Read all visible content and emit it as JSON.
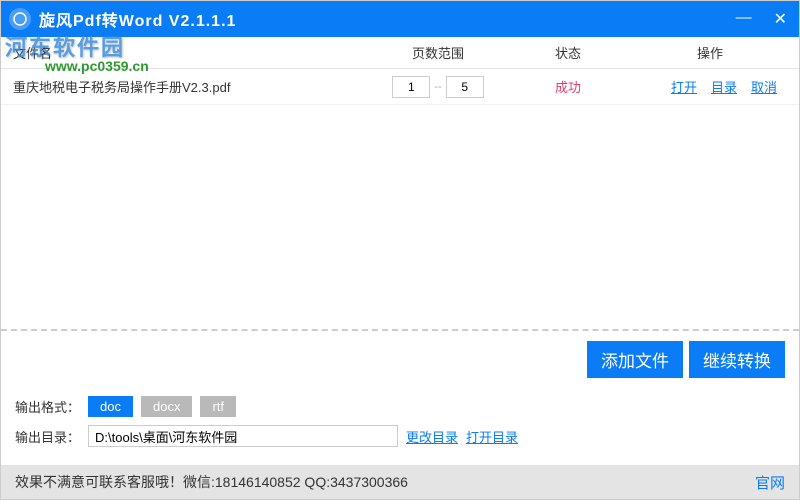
{
  "titlebar": {
    "title": "旋风Pdf转Word  V2.1.1.1"
  },
  "watermark": {
    "line1": "河东软件园",
    "line2": "www.pc0359.cn"
  },
  "table": {
    "headers": {
      "file": "文件名",
      "range": "页数范围",
      "status": "状态",
      "action": "操作"
    },
    "row": {
      "filename": "重庆地税电子税务局操作手册V2.3.pdf",
      "range_from": "1",
      "range_sep": "--",
      "range_to": "5",
      "status": "成功",
      "open": "打开",
      "dir": "目录",
      "cancel": "取消"
    }
  },
  "toolbar": {
    "add": "添加文件",
    "convert": "继续转换"
  },
  "options": {
    "format_label": "输出格式：",
    "formats": {
      "doc": "doc",
      "docx": "docx",
      "rtf": "rtf"
    },
    "outdir_label": "输出目录：",
    "outdir_value": "D:\\tools\\桌面\\河东软件园",
    "change_dir": "更改目录",
    "open_dir": "打开目录"
  },
  "footer": {
    "text": "效果不满意可联系客服哦！微信:18146140852 QQ:3437300366",
    "site": "官网"
  }
}
